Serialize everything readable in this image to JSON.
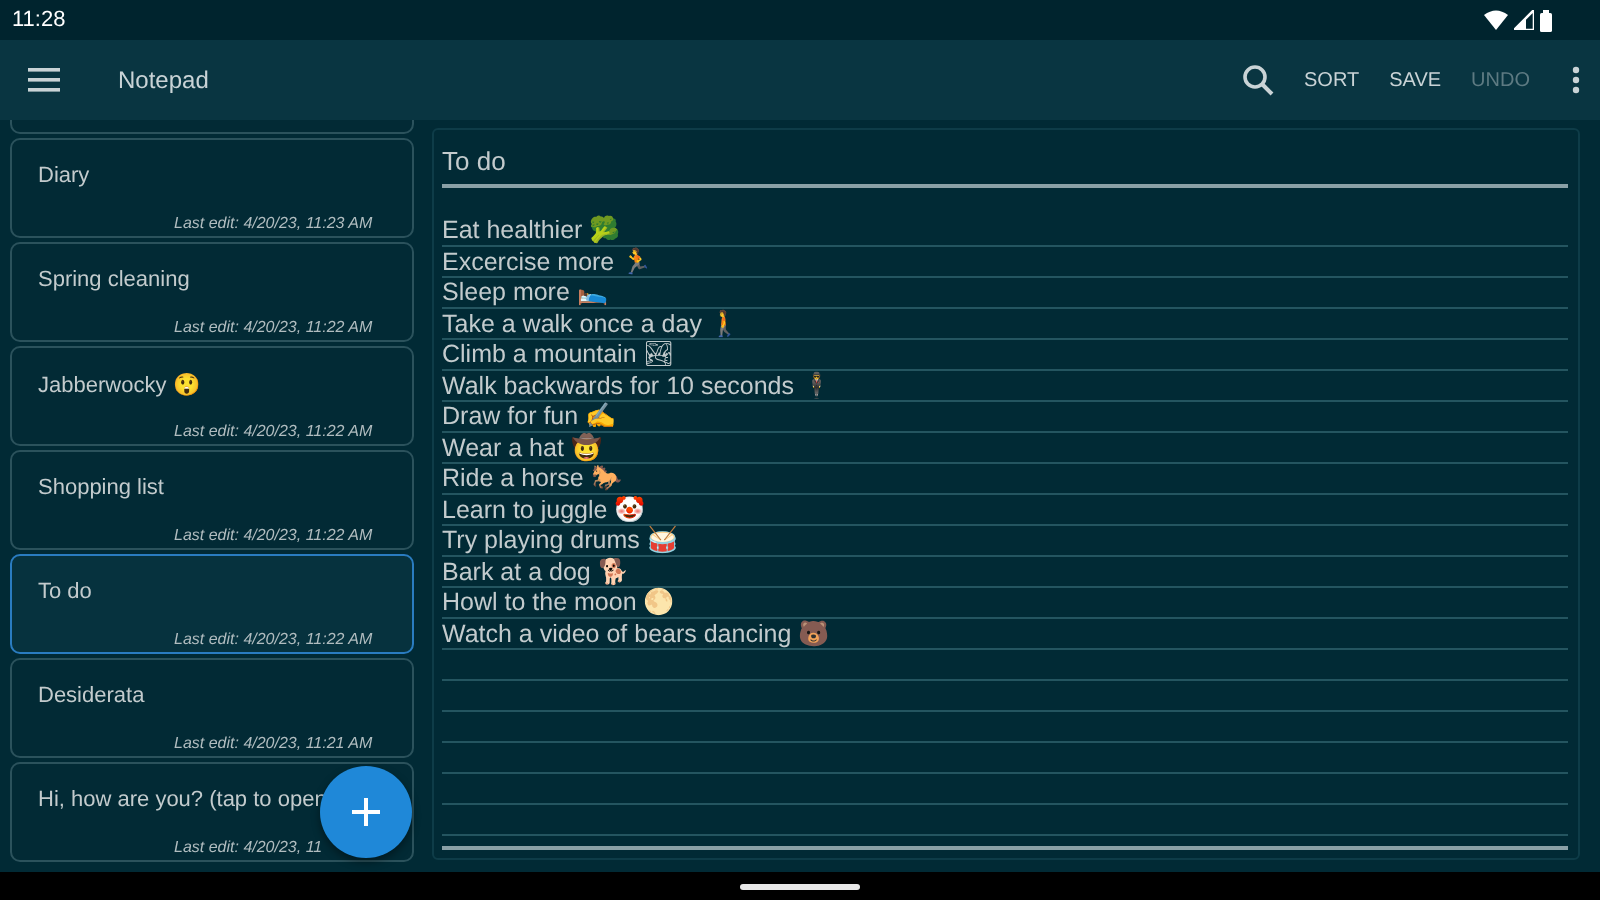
{
  "status_bar": {
    "time": "11:28"
  },
  "toolbar": {
    "title": "Notepad",
    "actions": [
      {
        "label": "SORT",
        "disabled": false
      },
      {
        "label": "SAVE",
        "disabled": false
      },
      {
        "label": "UNDO",
        "disabled": true
      }
    ]
  },
  "notes": [
    {
      "title": "Diary",
      "last_edit": "Last edit: 4/20/23, 11:23 AM",
      "selected": false
    },
    {
      "title": "Spring cleaning",
      "last_edit": "Last edit: 4/20/23, 11:22 AM",
      "selected": false
    },
    {
      "title": "Jabberwocky 😲",
      "last_edit": "Last edit: 4/20/23, 11:22 AM",
      "selected": false
    },
    {
      "title": "Shopping list",
      "last_edit": "Last edit: 4/20/23, 11:22 AM",
      "selected": false
    },
    {
      "title": "To do",
      "last_edit": "Last edit: 4/20/23, 11:22 AM",
      "selected": true
    },
    {
      "title": "Desiderata",
      "last_edit": "Last edit: 4/20/23, 11:21 AM",
      "selected": false
    },
    {
      "title": "Hi, how are you? (tap to open",
      "last_edit": "Last edit: 4/20/23, 11",
      "selected": false
    }
  ],
  "editor": {
    "title": "To do",
    "lines": [
      "Eat healthier 🥦",
      "Excercise more 🏃",
      "Sleep more 🛌",
      "Take a walk once a day 🚶",
      "Climb a mountain 🏞",
      "Walk backwards for 10 seconds  🕴",
      "Draw for fun ✍",
      "Wear a hat 🤠",
      "Ride a horse 🐎",
      "Learn to juggle 🤡",
      "Try playing drums 🥁",
      "Bark at a dog 🐕",
      "Howl to the moon 🌕",
      "Watch a video of bears dancing 🐻"
    ]
  }
}
